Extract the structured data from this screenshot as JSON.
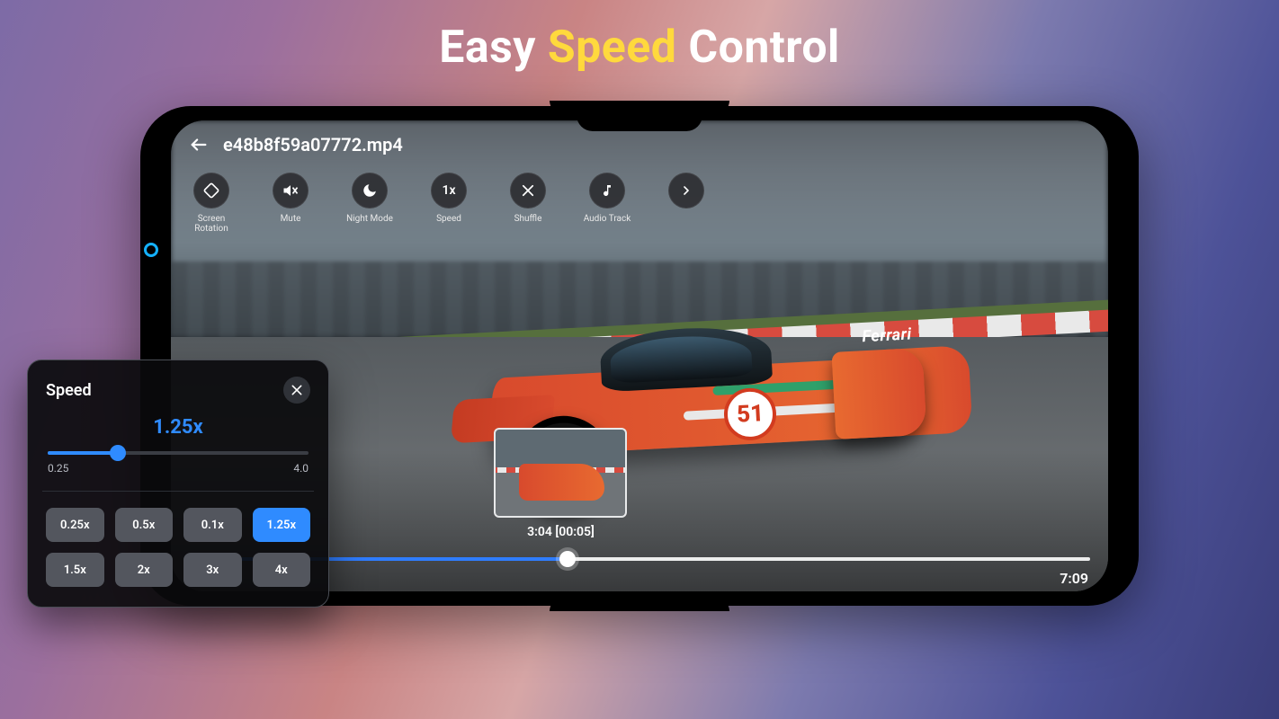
{
  "headline": {
    "w1": "Easy",
    "w2": "Speed",
    "w3": "Control"
  },
  "player": {
    "filename": "e48b8f59a07772.mp4",
    "quick_actions": [
      {
        "id": "screen-rotation",
        "label": "Screen Rotation",
        "icon": "rotate"
      },
      {
        "id": "mute",
        "label": "Mute",
        "icon": "mute"
      },
      {
        "id": "night-mode",
        "label": "Night Mode",
        "icon": "moon"
      },
      {
        "id": "speed",
        "label": "Speed",
        "icon": "1x",
        "text": "1x"
      },
      {
        "id": "shuffle",
        "label": "Shuffle",
        "icon": "shuffle"
      },
      {
        "id": "audio-track",
        "label": "Audio Track",
        "icon": "note"
      },
      {
        "id": "more",
        "label": "",
        "icon": "chev-right"
      }
    ],
    "progress": {
      "current": "3:04",
      "total": "7:09",
      "percent": 42
    },
    "preview_label": "3:04 [00:05]",
    "car_number": "51",
    "car_brand": "Ferrari"
  },
  "speed_panel": {
    "title": "Speed",
    "current": "1.25x",
    "min": "0.25",
    "max": "4.0",
    "slider_percent": 27,
    "presets": [
      "0.25x",
      "0.5x",
      "0.1x",
      "1.25x",
      "1.5x",
      "2x",
      "3x",
      "4x"
    ],
    "active_preset_index": 3
  }
}
